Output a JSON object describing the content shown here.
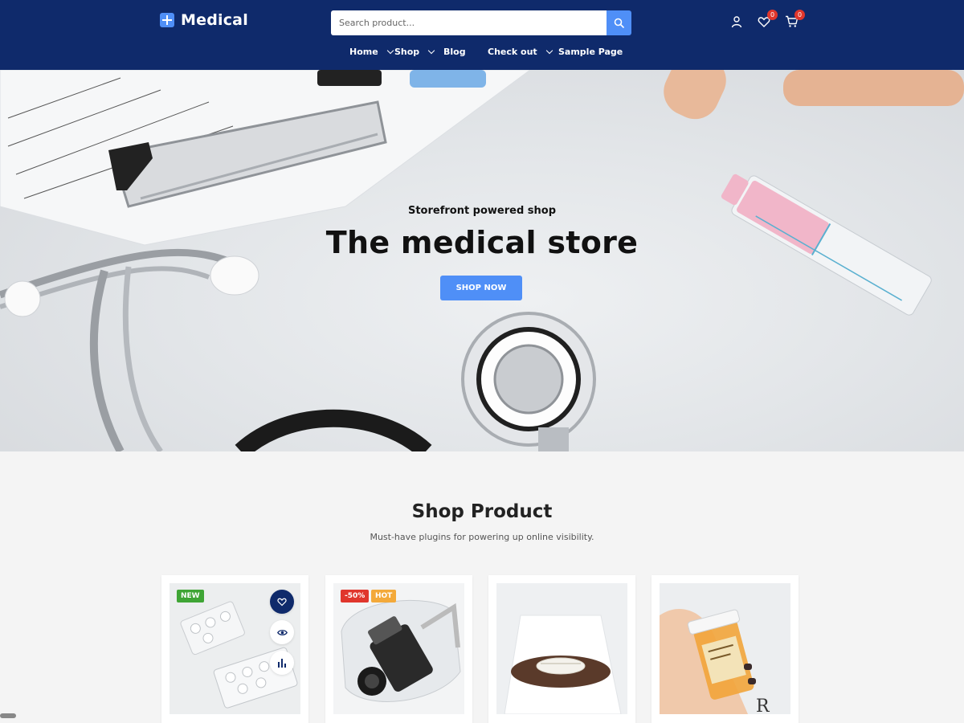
{
  "header": {
    "logo_text": "Medical",
    "search_placeholder": "Search product...",
    "wishlist_count": "0",
    "cart_count": "0",
    "nav": [
      {
        "label": "Home"
      },
      {
        "label": "Shop"
      },
      {
        "label": "Blog"
      },
      {
        "label": "Check out"
      },
      {
        "label": "Sample Page"
      }
    ]
  },
  "hero": {
    "subtitle": "Storefront powered shop",
    "title": "The medical store",
    "button": "SHOP NOW"
  },
  "shop": {
    "title": "Shop Product",
    "subtitle": "Must-have plugins for powering up online visibility.",
    "products": [
      {
        "tags": [
          "NEW"
        ]
      },
      {
        "tags": [
          "-50%",
          "HOT"
        ]
      },
      {
        "tags": []
      },
      {
        "tags": []
      }
    ]
  },
  "colors": {
    "header_bg": "#0f2a6b",
    "accent": "#4f8ff7",
    "badge": "#e0362c",
    "tag_new": "#3fa535",
    "tag_sale": "#e0362c",
    "tag_hot": "#f3a93a"
  }
}
